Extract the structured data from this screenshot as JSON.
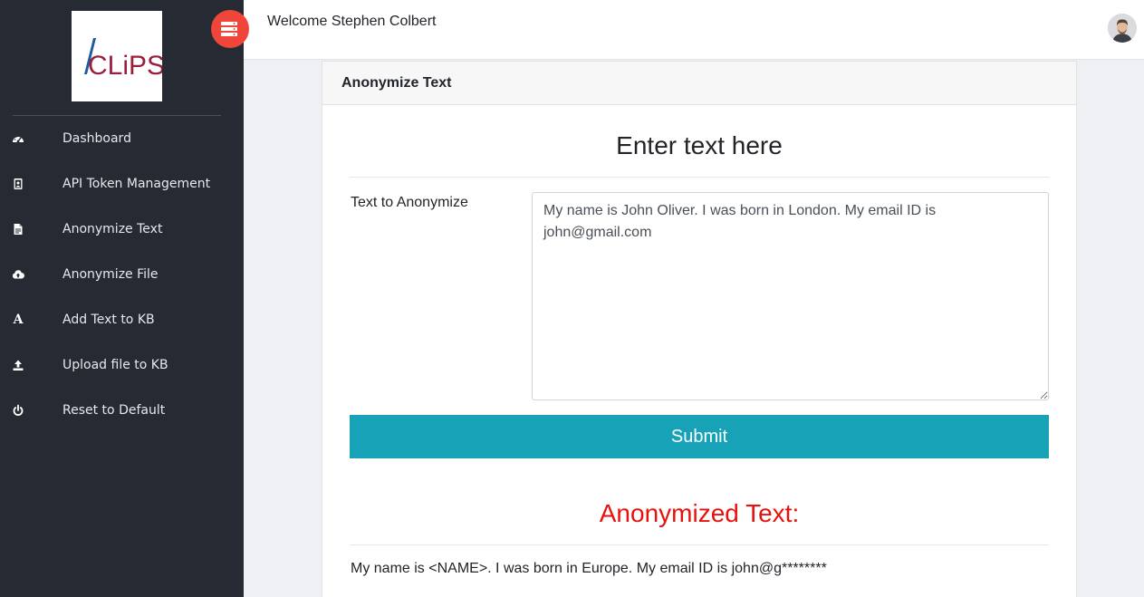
{
  "sidebar": {
    "logo": {
      "text": "CLiPS",
      "colors": {
        "slash": "#1e5aa0",
        "text": "#9b1f3c"
      }
    },
    "items": [
      {
        "label": "Dashboard",
        "icon": "dashboard-icon"
      },
      {
        "label": "API Token Management",
        "icon": "id-badge-icon"
      },
      {
        "label": "Anonymize Text",
        "icon": "document-icon"
      },
      {
        "label": "Anonymize File",
        "icon": "cloud-upload-icon"
      },
      {
        "label": "Add Text to KB",
        "icon": "font-icon",
        "glyph": "A"
      },
      {
        "label": "Upload file to KB",
        "icon": "upload-icon"
      },
      {
        "label": "Reset to Default",
        "icon": "power-icon"
      }
    ]
  },
  "header": {
    "welcome": "Welcome Stephen Colbert",
    "toggle_icon": "menu-list-icon",
    "avatar_icon": "user-avatar"
  },
  "card": {
    "title": "Anonymize Text",
    "form": {
      "heading": "Enter text here",
      "label": "Text to Anonymize",
      "value": "My name is John Oliver. I was born in London. My email ID is john@gmail.com",
      "submit_label": "Submit"
    },
    "result": {
      "heading": "Anonymized Text:",
      "text": "My name is <NAME>. I was born in Europe. My email ID is john@g********"
    }
  },
  "colors": {
    "sidebar_bg": "#262b33",
    "accent_button": "#17a2b8",
    "toggle": "#f0463a",
    "result_heading": "#e8120c"
  }
}
